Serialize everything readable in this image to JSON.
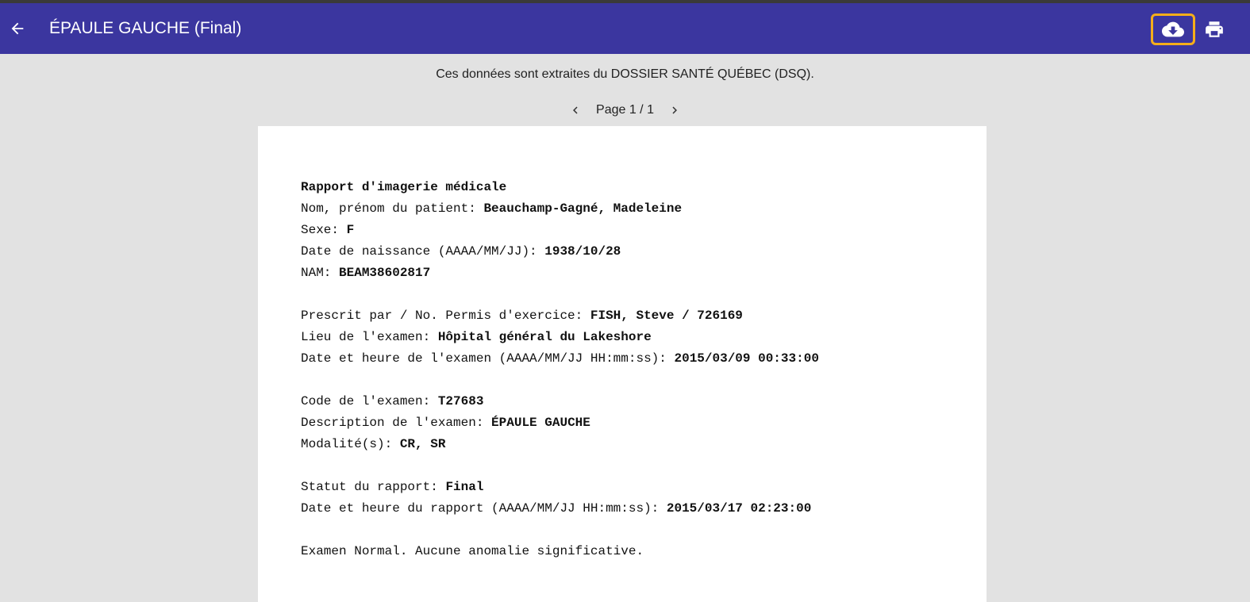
{
  "header": {
    "title": "ÉPAULE GAUCHE (Final)",
    "back_icon": "arrow-left-icon",
    "download_icon": "cloud-download-icon",
    "print_icon": "printer-icon",
    "bar_color": "#3b369f",
    "highlight_color": "#f5ae1a"
  },
  "source_note": "Ces données sont extraites du DOSSIER SANTÉ QUÉBEC (DSQ).",
  "pager": {
    "label": "Page 1 / 1"
  },
  "report": {
    "title": "Rapport d'imagerie médicale",
    "patient_name_label": "Nom, prénom du patient: ",
    "patient_name": "Beauchamp-Gagné, Madeleine",
    "sex_label": "Sexe: ",
    "sex": "F",
    "dob_label": "Date de naissance (AAAA/MM/JJ): ",
    "dob": "1938/10/28",
    "nam_label": "NAM: ",
    "nam": "BEAM38602817",
    "prescriber_label": "Prescrit par / No. Permis d'exercice: ",
    "prescriber": "FISH, Steve / 726169",
    "location_label": "Lieu de l'examen: ",
    "location": "Hôpital général du Lakeshore",
    "exam_datetime_label": "Date et heure de l'examen (AAAA/MM/JJ HH:mm:ss): ",
    "exam_datetime": "2015/03/09 00:33:00",
    "exam_code_label": "Code de l'examen: ",
    "exam_code": "T27683",
    "exam_desc_label": "Description de l'examen: ",
    "exam_desc": "ÉPAULE GAUCHE",
    "modality_label": "Modalité(s): ",
    "modality": "CR, SR",
    "status_label": "Statut du rapport: ",
    "status": "Final",
    "report_datetime_label": "Date et heure du rapport (AAAA/MM/JJ HH:mm:ss): ",
    "report_datetime": "2015/03/17 02:23:00",
    "conclusion": "Examen Normal. Aucune anomalie significative."
  }
}
